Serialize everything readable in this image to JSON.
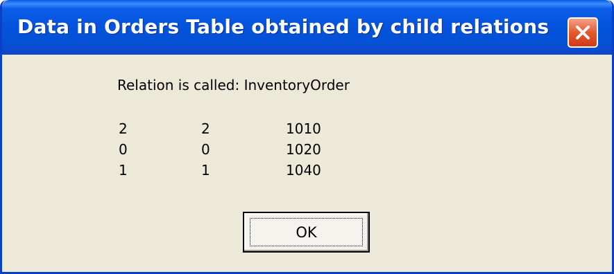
{
  "window": {
    "title": "Data in Orders Table obtained by child relations"
  },
  "content": {
    "relation_label": "Relation is called: InventoryOrder",
    "rows": [
      [
        "2",
        "2",
        "1010"
      ],
      [
        "0",
        "0",
        "1020"
      ],
      [
        "1",
        "1",
        "1040"
      ]
    ]
  },
  "buttons": {
    "ok_label": "OK",
    "close_icon": "close-icon"
  },
  "colors": {
    "titlebar": "#0553dd",
    "window_body": "#ece9d8",
    "close_button": "#e4592f"
  }
}
